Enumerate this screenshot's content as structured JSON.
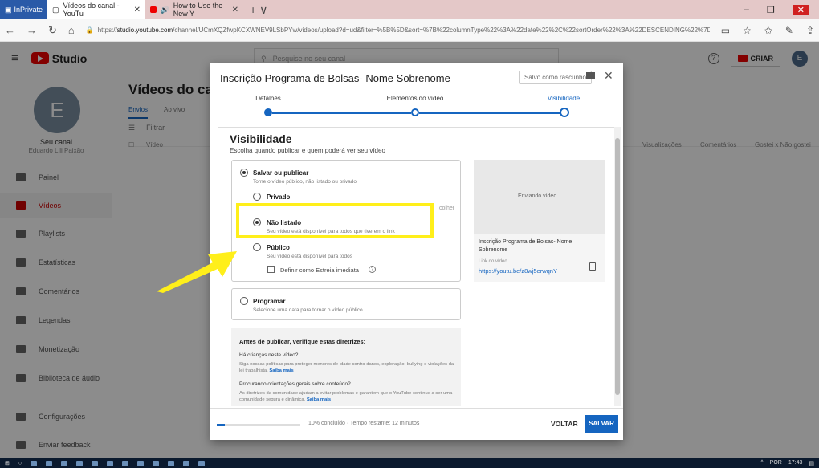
{
  "browser": {
    "private_label": "InPrivate",
    "tabs": [
      {
        "label": "Vídeos do canal - YouTu",
        "active": true
      },
      {
        "label": "How to Use the New Y",
        "active": false
      }
    ],
    "url_prefix": "https://",
    "url_host": "studio.youtube.com",
    "url_path": "/channel/UCmXQZfwpKCXWNEV9LSbPYw/videos/upload?d=ud&filter=%5B%5D&sort=%7B%22columnType%22%3A%22date%22%2C%22sortOrder%22%3A%22DESCENDING%22%7D"
  },
  "studio": {
    "logo_text": "Studio",
    "search_placeholder": "Pesquise no seu canal",
    "create_label": "CRIAR",
    "avatar_letter": "E"
  },
  "sidebar": {
    "avatar_letter": "E",
    "channel_label": "Seu canal",
    "channel_name": "Eduardo Lili Paixão",
    "items": [
      {
        "label": "Painel",
        "icon": "dashboard-icon"
      },
      {
        "label": "Vídeos",
        "icon": "video-icon",
        "active": true
      },
      {
        "label": "Playlists",
        "icon": "playlist-icon"
      },
      {
        "label": "Estatísticas",
        "icon": "analytics-icon"
      },
      {
        "label": "Comentários",
        "icon": "comments-icon"
      },
      {
        "label": "Legendas",
        "icon": "subtitles-icon"
      },
      {
        "label": "Monetização",
        "icon": "dollar-icon"
      },
      {
        "label": "Biblioteca de áudio",
        "icon": "audio-library-icon"
      },
      {
        "label": "Configurações",
        "icon": "gear-icon"
      },
      {
        "label": "Enviar feedback",
        "icon": "feedback-icon"
      }
    ]
  },
  "main": {
    "title": "Vídeos do canal",
    "tabs": [
      "Envios",
      "Ao vivo"
    ],
    "filter": "Filtrar",
    "columns": {
      "video": "Vídeo",
      "views": "Visualizações",
      "comments": "Comentários",
      "likes": "Gostei x Não gostei"
    }
  },
  "dialog": {
    "title": "Inscrição Programa de Bolsas- Nome Sobrenome",
    "draft_label": "Salvo como rascunho",
    "steps": [
      {
        "label": "Detalhes",
        "state": "done"
      },
      {
        "label": "Elementos do vídeo",
        "state": "done"
      },
      {
        "label": "Visibilidade",
        "state": "current"
      }
    ],
    "visibility_title": "Visibilidade",
    "visibility_sub": "Escolha quando publicar e quem poderá ver seu vídeo",
    "save_publish": {
      "label": "Salvar ou publicar",
      "desc": "Torne o vídeo público, não listado ou privado"
    },
    "options": [
      {
        "label": "Privado",
        "desc": "",
        "selected": false
      },
      {
        "label": "Não listado",
        "desc": "Seu vídeo está disponível para todos que tiverem o link",
        "selected": true
      },
      {
        "label": "Público",
        "desc": "Seu vídeo está disponível para todos",
        "selected": false
      }
    ],
    "premiere_label": "Definir como Estreia imediata",
    "hidden_text_fragment": "colher",
    "schedule": {
      "label": "Programar",
      "desc": "Selecione uma data para tornar o vídeo público"
    },
    "preview": {
      "status": "Enviando vídeo...",
      "title": "Inscrição Programa de Bolsas- Nome Sobrenome",
      "link_label": "Link do vídeo",
      "link": "https://youtu.be/z8wj5erwqnY"
    },
    "checklist": {
      "heading": "Antes de publicar, verifique estas diretrizes:",
      "q1": "Há crianças neste vídeo?",
      "t1": "Siga nossas políticas para proteger menores de idade contra danos, exploração, bullying e violações da lei trabalhista.",
      "more1": "Saiba mais",
      "q2": "Procurando orientações gerais sobre conteúdo?",
      "t2": "As diretrizes da comunidade ajudam a evitar problemas e garantem que o YouTube continue a ser uma comunidade segura e dinâmica.",
      "more2": "Saiba mais"
    },
    "footer": {
      "progress": 0.1,
      "status": "10% concluído · Tempo restante: 12 minutos",
      "back": "VOLTAR",
      "save": "SALVAR"
    }
  },
  "taskbar": {
    "lang": "POR",
    "time": "17:43"
  },
  "colors": {
    "accent": "#1565c0",
    "highlight": "#ffef1a",
    "youtube_red": "#e00000"
  }
}
